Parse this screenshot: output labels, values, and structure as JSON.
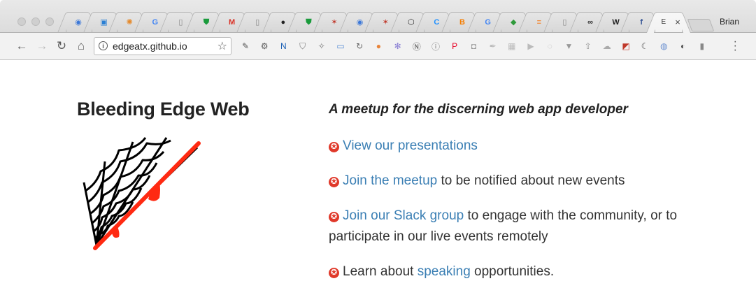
{
  "browser": {
    "profile_name": "Brian",
    "url": "edgeatx.github.io",
    "tabs": [
      {
        "icon": "chrome-tab-icon",
        "glyph": "◉",
        "color": "#3c78d8"
      },
      {
        "icon": "tab-blue-square-icon",
        "glyph": "▣",
        "color": "#2a7fd4"
      },
      {
        "icon": "tab-orange-circle-icon",
        "glyph": "✺",
        "color": "#e58a2c"
      },
      {
        "icon": "google-icon",
        "glyph": "G",
        "color": "#4285f4"
      },
      {
        "icon": "document-icon",
        "glyph": "▯",
        "color": "#888888"
      },
      {
        "icon": "shield-icon",
        "glyph": "⛊",
        "color": "#1a9b3c"
      },
      {
        "icon": "gmail-icon",
        "glyph": "M",
        "color": "#d93025"
      },
      {
        "icon": "document-icon",
        "glyph": "▯",
        "color": "#888888"
      },
      {
        "icon": "github-icon",
        "glyph": "●",
        "color": "#222222"
      },
      {
        "icon": "shield-icon",
        "glyph": "⛊",
        "color": "#1a9b3c"
      },
      {
        "icon": "spiderweb-icon",
        "glyph": "✶",
        "color": "#c0392b"
      },
      {
        "icon": "chrome-tab-icon",
        "glyph": "◉",
        "color": "#3c78d8"
      },
      {
        "icon": "spiderweb-icon",
        "glyph": "✶",
        "color": "#c0392b"
      },
      {
        "icon": "codepen-icon",
        "glyph": "⬡",
        "color": "#333333"
      },
      {
        "icon": "tab-blue-c-icon",
        "glyph": "C",
        "color": "#1e90ff"
      },
      {
        "icon": "blogger-icon",
        "glyph": "B",
        "color": "#f57d00"
      },
      {
        "icon": "google-icon",
        "glyph": "G",
        "color": "#4285f4"
      },
      {
        "icon": "green-cube-icon",
        "glyph": "◆",
        "color": "#2e9a3a"
      },
      {
        "icon": "stackoverflow-icon",
        "glyph": "≡",
        "color": "#f48024"
      },
      {
        "icon": "document-icon",
        "glyph": "▯",
        "color": "#888888"
      },
      {
        "icon": "tab-dark-square-icon",
        "glyph": "∞",
        "color": "#333333"
      },
      {
        "icon": "wikipedia-icon",
        "glyph": "W",
        "color": "#222222"
      },
      {
        "icon": "facebook-icon",
        "glyph": "f",
        "color": "#3b5998"
      }
    ],
    "active_tab": {
      "label": "E",
      "close": "×"
    },
    "extensions": [
      {
        "icon": "eyedropper-icon",
        "glyph": "✎",
        "color": "#555"
      },
      {
        "icon": "gear-icon",
        "glyph": "⚙",
        "color": "#555"
      },
      {
        "icon": "notion-n-icon",
        "glyph": "N",
        "color": "#1a5fb4"
      },
      {
        "icon": "pocket-icon",
        "glyph": "⛉",
        "color": "#777"
      },
      {
        "icon": "wand-icon",
        "glyph": "✧",
        "color": "#777"
      },
      {
        "icon": "folder-icon",
        "glyph": "▭",
        "color": "#5b8fd6"
      },
      {
        "icon": "sync-icon",
        "glyph": "↻",
        "color": "#666"
      },
      {
        "icon": "orange-circle-icon",
        "glyph": "●",
        "color": "#e8843a"
      },
      {
        "icon": "puzzle-icon",
        "glyph": "✻",
        "color": "#8a7fd4"
      },
      {
        "icon": "n-circle-icon",
        "glyph": "Ⓝ",
        "color": "#555"
      },
      {
        "icon": "info-circle-icon",
        "glyph": "ⓘ",
        "color": "#777"
      },
      {
        "icon": "pinterest-icon",
        "glyph": "P",
        "color": "#e60023"
      },
      {
        "icon": "camera-icon",
        "glyph": "◘",
        "color": "#999"
      },
      {
        "icon": "feather-icon",
        "glyph": "✒",
        "color": "#bbb"
      },
      {
        "icon": "grid-icon",
        "glyph": "▦",
        "color": "#bbb"
      },
      {
        "icon": "play-icon",
        "glyph": "▶",
        "color": "#bbb"
      },
      {
        "icon": "ghost-icon",
        "glyph": "◌",
        "color": "#bbb"
      },
      {
        "icon": "vue-icon",
        "glyph": "▼",
        "color": "#999"
      },
      {
        "icon": "upload-icon",
        "glyph": "⇧",
        "color": "#999"
      },
      {
        "icon": "cloud-icon",
        "glyph": "☁",
        "color": "#aaa"
      },
      {
        "icon": "flag-icon",
        "glyph": "◩",
        "color": "#c0392b"
      },
      {
        "icon": "moon-icon",
        "glyph": "☾",
        "color": "#555"
      },
      {
        "icon": "globe-icon",
        "glyph": "◍",
        "color": "#6a8fd0"
      },
      {
        "icon": "half-circle-icon",
        "glyph": "◐",
        "color": "#444"
      },
      {
        "icon": "translate-icon",
        "glyph": "▮",
        "color": "#888"
      }
    ]
  },
  "page": {
    "title": "Bleeding Edge Web",
    "tagline": "A meetup for the discerning web app developer",
    "item1": {
      "link": "View our presentations"
    },
    "item2": {
      "link": "Join the meetup",
      "text": " to be notified about new events"
    },
    "item3": {
      "link": "Join our Slack group",
      "text": " to engage with the community, or to participate in our live events remotely"
    },
    "item4": {
      "prefix": "Learn about ",
      "link": "speaking",
      "text": " opportunities."
    },
    "bullet": "✪"
  },
  "colors": {
    "link": "#3b7fb4",
    "bullet": "#e0392a",
    "web_stroke": "#000000",
    "web_accent": "#ff2a12"
  }
}
